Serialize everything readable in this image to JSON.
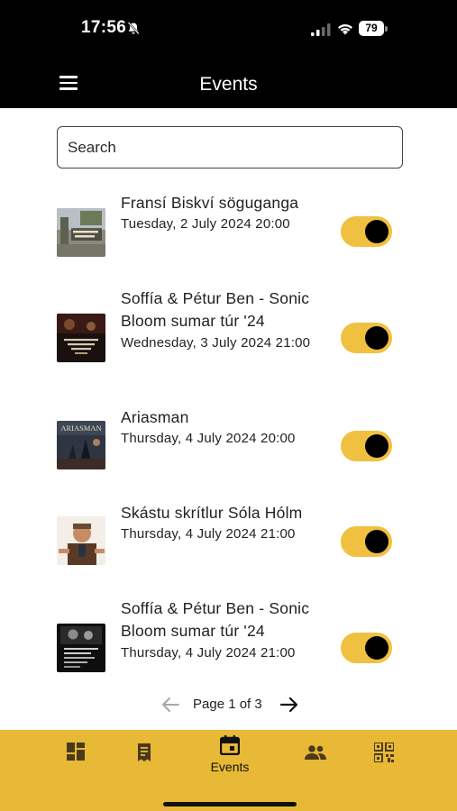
{
  "status_bar": {
    "time": "17:56",
    "battery": "79",
    "icons": [
      "bell-slash-icon",
      "cellular-signal-icon",
      "wifi-icon",
      "battery-icon"
    ]
  },
  "app_bar": {
    "title": "Events",
    "menu_icon": "hamburger-menu-icon"
  },
  "search": {
    "placeholder": "Search"
  },
  "events": [
    {
      "title": "Fransí Biskví söguganga",
      "date": "Tuesday, 2 July 2024 20:00",
      "enabled": true,
      "thumb_caption": "Fransí Biskví söguganga"
    },
    {
      "title": "Soffía & Pétur Ben - Sonic Bloom sumar túr '24",
      "date": "Wednesday, 3 July 2024 21:00",
      "enabled": true,
      "thumb_caption": ""
    },
    {
      "title": "Ariasman",
      "date": "Thursday, 4 July 2024 20:00",
      "enabled": true,
      "thumb_caption": "ARIASMAN"
    },
    {
      "title": "Skástu skrítlur Sóla Hólm",
      "date": "Thursday, 4 July 2024 21:00",
      "enabled": true,
      "thumb_caption": ""
    },
    {
      "title": "Soffía & Pétur Ben - Sonic Bloom sumar túr '24",
      "date": "Thursday, 4 July 2024 21:00",
      "enabled": true,
      "thumb_caption": ""
    }
  ],
  "pagination": {
    "label": "Page 1 of 3",
    "prev_icon": "arrow-left-icon",
    "next_icon": "arrow-right-icon"
  },
  "bottom_nav": {
    "items": [
      {
        "icon": "dashboard-icon",
        "label": "",
        "active": false
      },
      {
        "icon": "ticket-icon",
        "label": "",
        "active": false
      },
      {
        "icon": "calendar-icon",
        "label": "Events",
        "active": true
      },
      {
        "icon": "people-icon",
        "label": "",
        "active": false
      },
      {
        "icon": "qr-code-icon",
        "label": "",
        "active": false
      }
    ]
  },
  "colors": {
    "accent": "#e8b936",
    "toggle": "#f0c040",
    "header_bg": "#000000",
    "knob": "#000000"
  }
}
